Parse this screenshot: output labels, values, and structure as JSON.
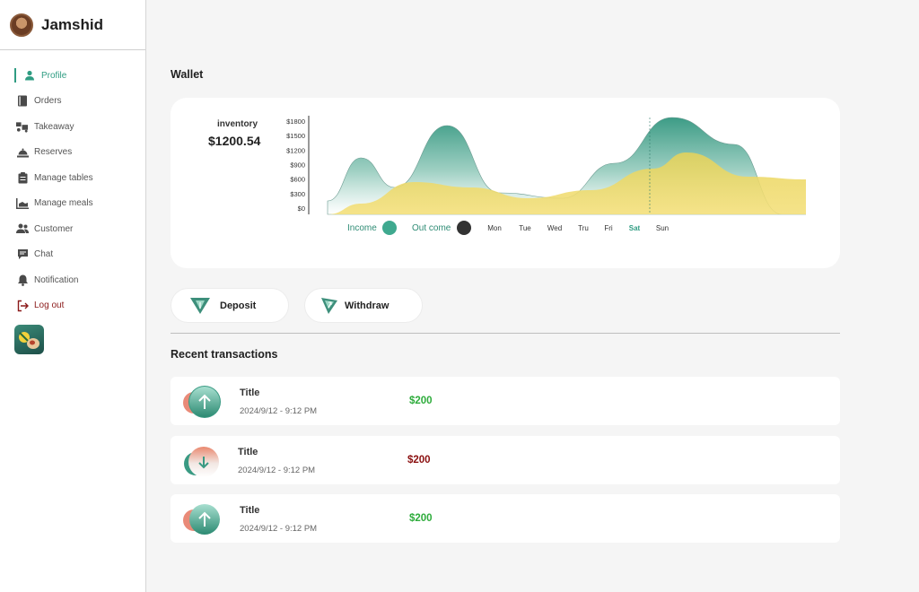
{
  "user": {
    "name": "Jamshid"
  },
  "nav": [
    {
      "label": "Profile",
      "icon": "user-icon",
      "active": true
    },
    {
      "label": "Orders",
      "icon": "book-icon"
    },
    {
      "label": "Takeaway",
      "icon": "takeaway-icon"
    },
    {
      "label": "Reserves",
      "icon": "bell-tray-icon"
    },
    {
      "label": "Manage tables",
      "icon": "clipboard-icon"
    },
    {
      "label": "Manage meals",
      "icon": "meals-icon"
    },
    {
      "label": "Customer",
      "icon": "users-icon"
    },
    {
      "label": "Chat",
      "icon": "chat-icon"
    },
    {
      "label": "Notification",
      "icon": "notification-bell-icon"
    },
    {
      "label": "Log out",
      "icon": "logout-icon"
    }
  ],
  "wallet": {
    "title": "Wallet",
    "inventory_label": "inventory",
    "inventory_value": "$1200.54"
  },
  "chart_data": {
    "type": "area",
    "y_ticks": [
      "$1800",
      "$1500",
      "$1200",
      "$900",
      "$600",
      "$300",
      "$0"
    ],
    "ylim": [
      0,
      1800
    ],
    "legend": [
      {
        "label": "Income",
        "color": "#3fa98f"
      },
      {
        "label": "Out come",
        "color": "#333333"
      }
    ],
    "days": [
      "Mon",
      "Tue",
      "Wed",
      "Tru",
      "Fri",
      "Sat",
      "Sun"
    ],
    "selected_day": "Sat",
    "series": [
      {
        "name": "Income",
        "color": "#3fa98f",
        "x": [
          0,
          7,
          14,
          25,
          36,
          49,
          60,
          72,
          85,
          95,
          100
        ],
        "values": [
          250,
          1050,
          500,
          1650,
          400,
          300,
          950,
          1800,
          1300,
          0,
          0
        ]
      },
      {
        "name": "Out come",
        "color": "#f3dc6e",
        "x": [
          0,
          7,
          18,
          30,
          42,
          55,
          68,
          75,
          88,
          100
        ],
        "values": [
          0,
          200,
          600,
          500,
          300,
          450,
          850,
          1150,
          700,
          650
        ]
      }
    ]
  },
  "actions": {
    "deposit": "Deposit",
    "withdraw": "Withdraw"
  },
  "transactions_title": "Recent transactions",
  "transactions": [
    {
      "title": "Title",
      "date": "2024/9/12 - 9:12 PM",
      "amount": "$200",
      "direction": "in"
    },
    {
      "title": "Title",
      "date": "2024/9/12 - 9:12 PM",
      "amount": "$200",
      "direction": "out"
    },
    {
      "title": "Title",
      "date": "2024/9/12 - 9:12 PM",
      "amount": "$200",
      "direction": "in"
    }
  ],
  "colors": {
    "accent": "#2f9c82",
    "logout": "#8b1a1a",
    "positive": "#2eac3c",
    "negative": "#8b1111"
  }
}
